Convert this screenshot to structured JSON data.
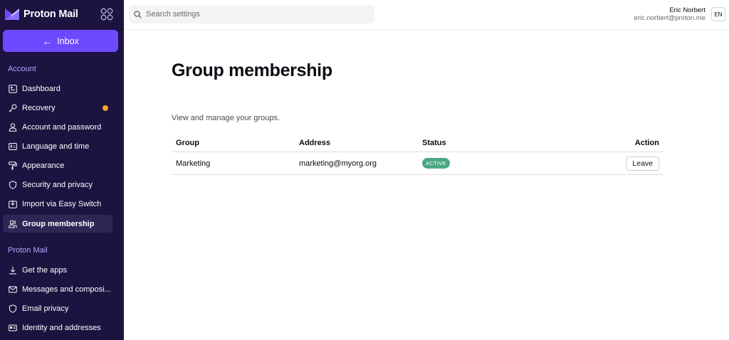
{
  "brand": {
    "name": "Proton Mail",
    "logo_icon": "proton-mail-logo-icon",
    "accent": "#6d4aff"
  },
  "sidebar": {
    "inbox_label": "Inbox",
    "sections": [
      {
        "label": "Account",
        "items": [
          {
            "label": "Dashboard",
            "icon": "dashboard-icon"
          },
          {
            "label": "Recovery",
            "icon": "key-icon",
            "notification": true
          },
          {
            "label": "Account and password",
            "icon": "user-icon"
          },
          {
            "label": "Language and time",
            "icon": "language-icon"
          },
          {
            "label": "Appearance",
            "icon": "paint-roller-icon"
          },
          {
            "label": "Security and privacy",
            "icon": "shield-icon"
          },
          {
            "label": "Import via Easy Switch",
            "icon": "import-icon"
          },
          {
            "label": "Group membership",
            "icon": "users-icon",
            "active": true
          }
        ]
      },
      {
        "label": "Proton Mail",
        "items": [
          {
            "label": "Get the apps",
            "icon": "download-icon"
          },
          {
            "label": "Messages and composi...",
            "icon": "envelope-icon"
          },
          {
            "label": "Email privacy",
            "icon": "shield-icon"
          },
          {
            "label": "Identity and addresses",
            "icon": "id-card-icon"
          }
        ]
      }
    ]
  },
  "search": {
    "placeholder": "Search settings",
    "value": ""
  },
  "user": {
    "name": "Eric Norbert",
    "email": "eric.norbert@proton.me"
  },
  "language": "EN",
  "main": {
    "title": "Group membership",
    "description": "View and manage your groups.",
    "table": {
      "headers": {
        "group": "Group",
        "address": "Address",
        "status": "Status",
        "action": "Action"
      },
      "rows": [
        {
          "group": "Marketing",
          "address": "marketing@myorg.org",
          "status": "ACTIVE",
          "action": "Leave"
        }
      ]
    }
  },
  "colors": {
    "sidebar_bg": "#1c1340",
    "active_badge": "#4ba884",
    "notification_dot": "#f5a623"
  }
}
